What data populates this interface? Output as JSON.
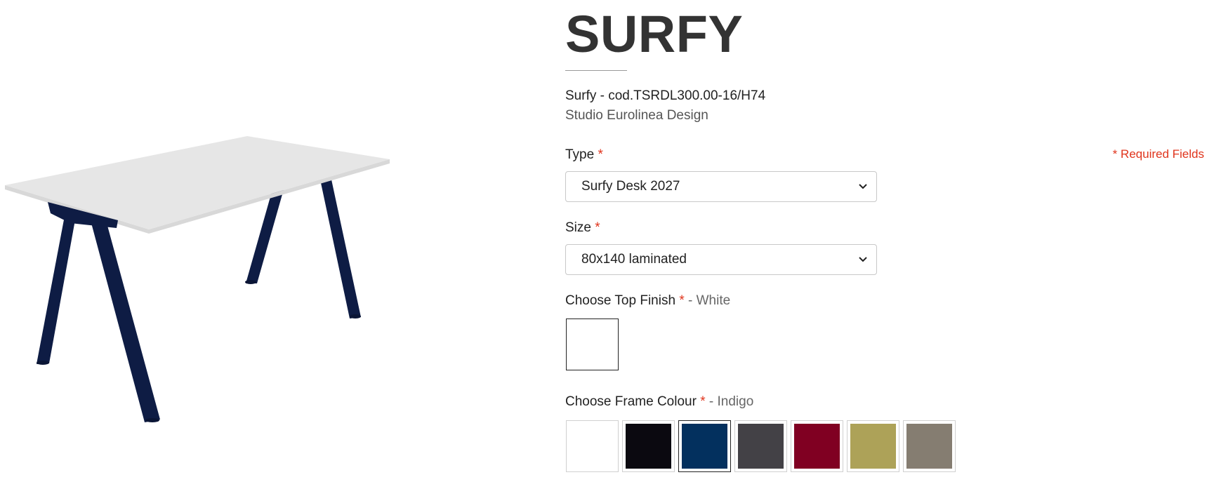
{
  "product": {
    "name": "SURFY",
    "code_line": "Surfy - cod.TSRDL300.00-16/H74",
    "designer": "Studio Eurolinea Design"
  },
  "form": {
    "required_note": "* Required Fields",
    "asterisk": "*",
    "type": {
      "label": "Type",
      "selected": "Surfy Desk 2027"
    },
    "size": {
      "label": "Size",
      "selected": "80x140 laminated"
    },
    "top_finish": {
      "label": "Choose Top Finish",
      "selected_suffix": "- White",
      "swatches": [
        {
          "name": "White",
          "color": "#ffffff",
          "selected": true
        }
      ]
    },
    "frame_colour": {
      "label": "Choose Frame Colour",
      "selected_suffix": "- Indigo",
      "swatches": [
        {
          "name": "White",
          "color": "#ffffff",
          "selected": false
        },
        {
          "name": "Black",
          "color": "#0b0910",
          "selected": false
        },
        {
          "name": "Indigo",
          "color": "#03305e",
          "selected": true
        },
        {
          "name": "Anthracite",
          "color": "#434146",
          "selected": false
        },
        {
          "name": "Red",
          "color": "#800022",
          "selected": false
        },
        {
          "name": "Olive",
          "color": "#ada258",
          "selected": false
        },
        {
          "name": "Taupe",
          "color": "#857d71",
          "selected": false
        }
      ]
    }
  },
  "image": {
    "icon": "desk-product-image",
    "top_color": "#e6e6e6",
    "frame_color": "#0e1c44"
  }
}
